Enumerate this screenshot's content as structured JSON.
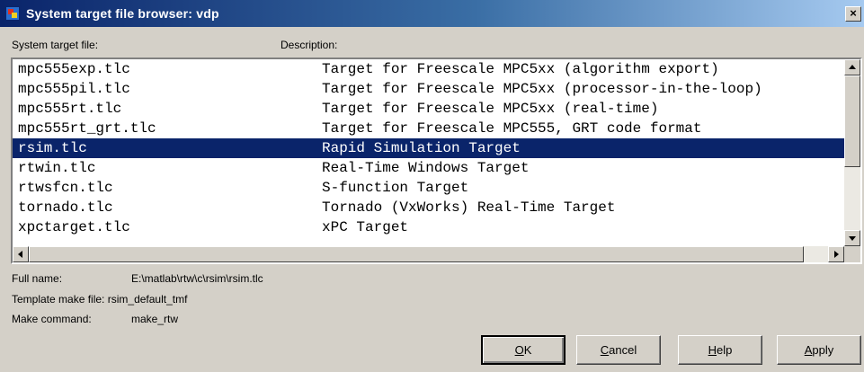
{
  "window": {
    "title": "System target file browser: vdp",
    "close_glyph": "×"
  },
  "columns": {
    "file": "System target file:",
    "description": "Description:"
  },
  "rows": [
    {
      "file": "mpc555exp.tlc",
      "description": "Target for Freescale MPC5xx (algorithm export)",
      "selected": false
    },
    {
      "file": "mpc555pil.tlc",
      "description": "Target for Freescale MPC5xx (processor-in-the-loop)",
      "selected": false
    },
    {
      "file": "mpc555rt.tlc",
      "description": "Target for Freescale MPC5xx (real-time)",
      "selected": false
    },
    {
      "file": "mpc555rt_grt.tlc",
      "description": "Target for Freescale MPC555, GRT code format",
      "selected": false
    },
    {
      "file": "rsim.tlc",
      "description": "Rapid Simulation Target",
      "selected": true
    },
    {
      "file": "rtwin.tlc",
      "description": "Real-Time Windows Target",
      "selected": false
    },
    {
      "file": "rtwsfcn.tlc",
      "description": "S-function Target",
      "selected": false
    },
    {
      "file": "tornado.tlc",
      "description": "Tornado (VxWorks) Real-Time Target",
      "selected": false
    },
    {
      "file": "xpctarget.tlc",
      "description": "xPC Target",
      "selected": false
    }
  ],
  "details": {
    "full_name_label": "Full name:",
    "full_name_value": "E:\\matlab\\rtw\\c\\rsim\\rsim.tlc",
    "template_label": "Template make file:",
    "template_value": "rsim_default_tmf",
    "make_label": "Make command:",
    "make_value": "make_rtw"
  },
  "buttons": {
    "ok": {
      "mnemonic": "O",
      "rest": "K"
    },
    "cancel": {
      "mnemonic": "C",
      "rest": "ancel"
    },
    "help": {
      "mnemonic": "H",
      "rest": "elp"
    },
    "apply": {
      "mnemonic": "A",
      "rest": "pply"
    }
  },
  "colors": {
    "selection": "#0a246a",
    "dialog_bg": "#d4d0c8"
  }
}
